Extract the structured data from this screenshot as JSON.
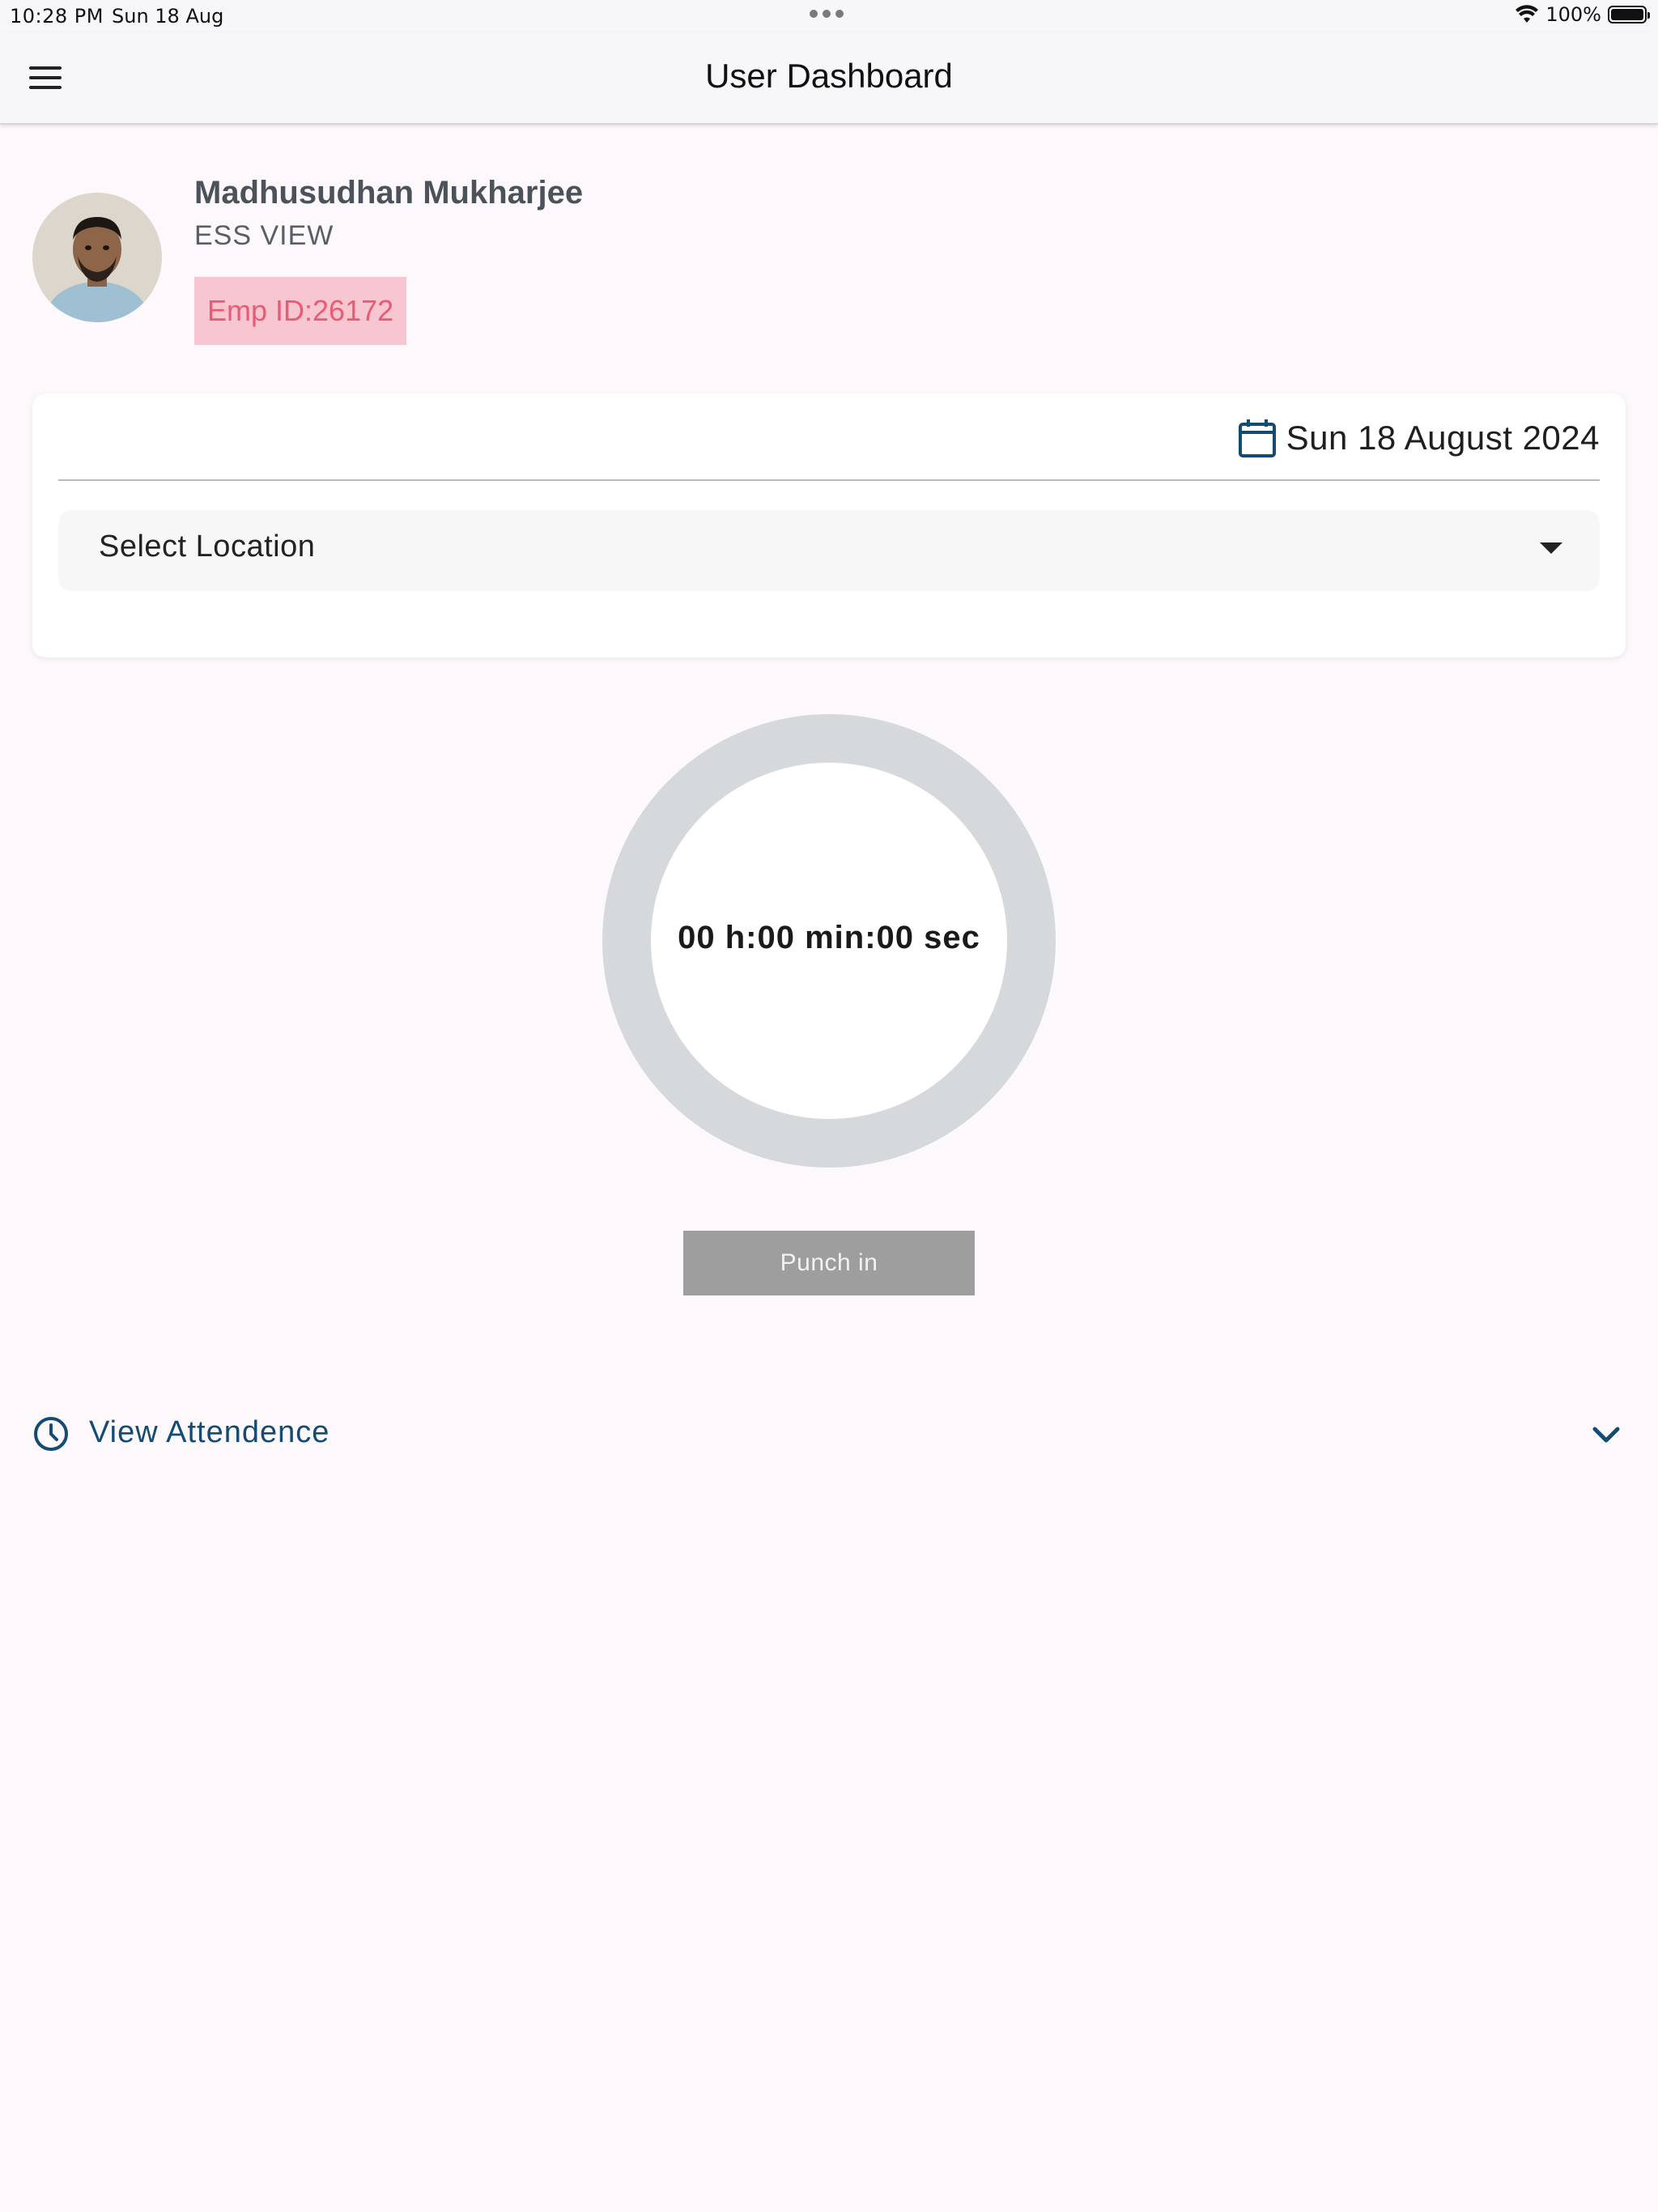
{
  "status_bar": {
    "time": "10:28 PM",
    "date": "Sun 18 Aug",
    "battery_percent": "100%",
    "icons": [
      "wifi-icon",
      "battery-icon"
    ]
  },
  "app_bar": {
    "title": "User Dashboard",
    "menu_icon": "menu-icon"
  },
  "profile": {
    "name": "Madhusudhan Mukharjee",
    "role": "ESS VIEW",
    "emp_id": "Emp ID:26172"
  },
  "attendance_card": {
    "date_icon": "calendar-icon",
    "date": "Sun 18 August 2024",
    "location_placeholder": "Select Location",
    "dropdown_icon": "chevron-down-icon"
  },
  "timer": {
    "display": "00 h:00 min:00 sec",
    "progress": 0
  },
  "actions": {
    "punch_label": "Punch in"
  },
  "view_attendance": {
    "icon": "clock-icon",
    "label": "View Attendence",
    "expand_icon": "chevron-down-icon"
  },
  "colors": {
    "background": "#fdf8fc",
    "app_bar": "#f7f7f9",
    "badge_bg": "#f7c6d0",
    "badge_text": "#e95a74",
    "accent_blue": "#134b72",
    "ring": "#d6d9dc",
    "button_disabled": "#9e9e9e"
  }
}
